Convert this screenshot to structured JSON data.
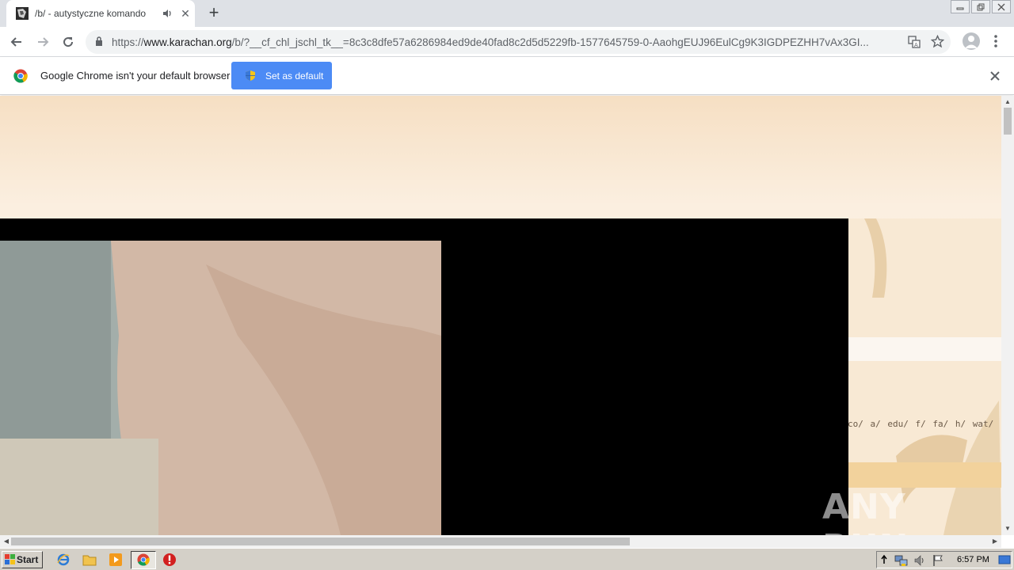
{
  "browser": {
    "tab": {
      "title": "/b/ - autystyczne komando"
    },
    "address": {
      "scheme": "https://",
      "host": "www.karachan.org",
      "path": "/b/?__cf_chl_jschl_tk__=8c3c8dfe57a6286984ed9de40fad8c2d5d5229fb-1577645759-0-AaohgEUJ96EulCg9K3IGDPEZHH7vAx3GI..."
    }
  },
  "infobar": {
    "message": "Google Chrome isn't your default browser",
    "button_label": "Set as default"
  },
  "page": {
    "board_links": "co/  a/  edu/  f/  fa/  h/  wat/  ku/",
    "watermark": "ANY RUN"
  },
  "taskbar": {
    "start_label": "Start",
    "clock": "6:57 PM"
  },
  "colors": {
    "infobar_button": "#4c8bf5",
    "tab_strip": "#dee1e6",
    "taskbar": "#d4d0c8"
  }
}
